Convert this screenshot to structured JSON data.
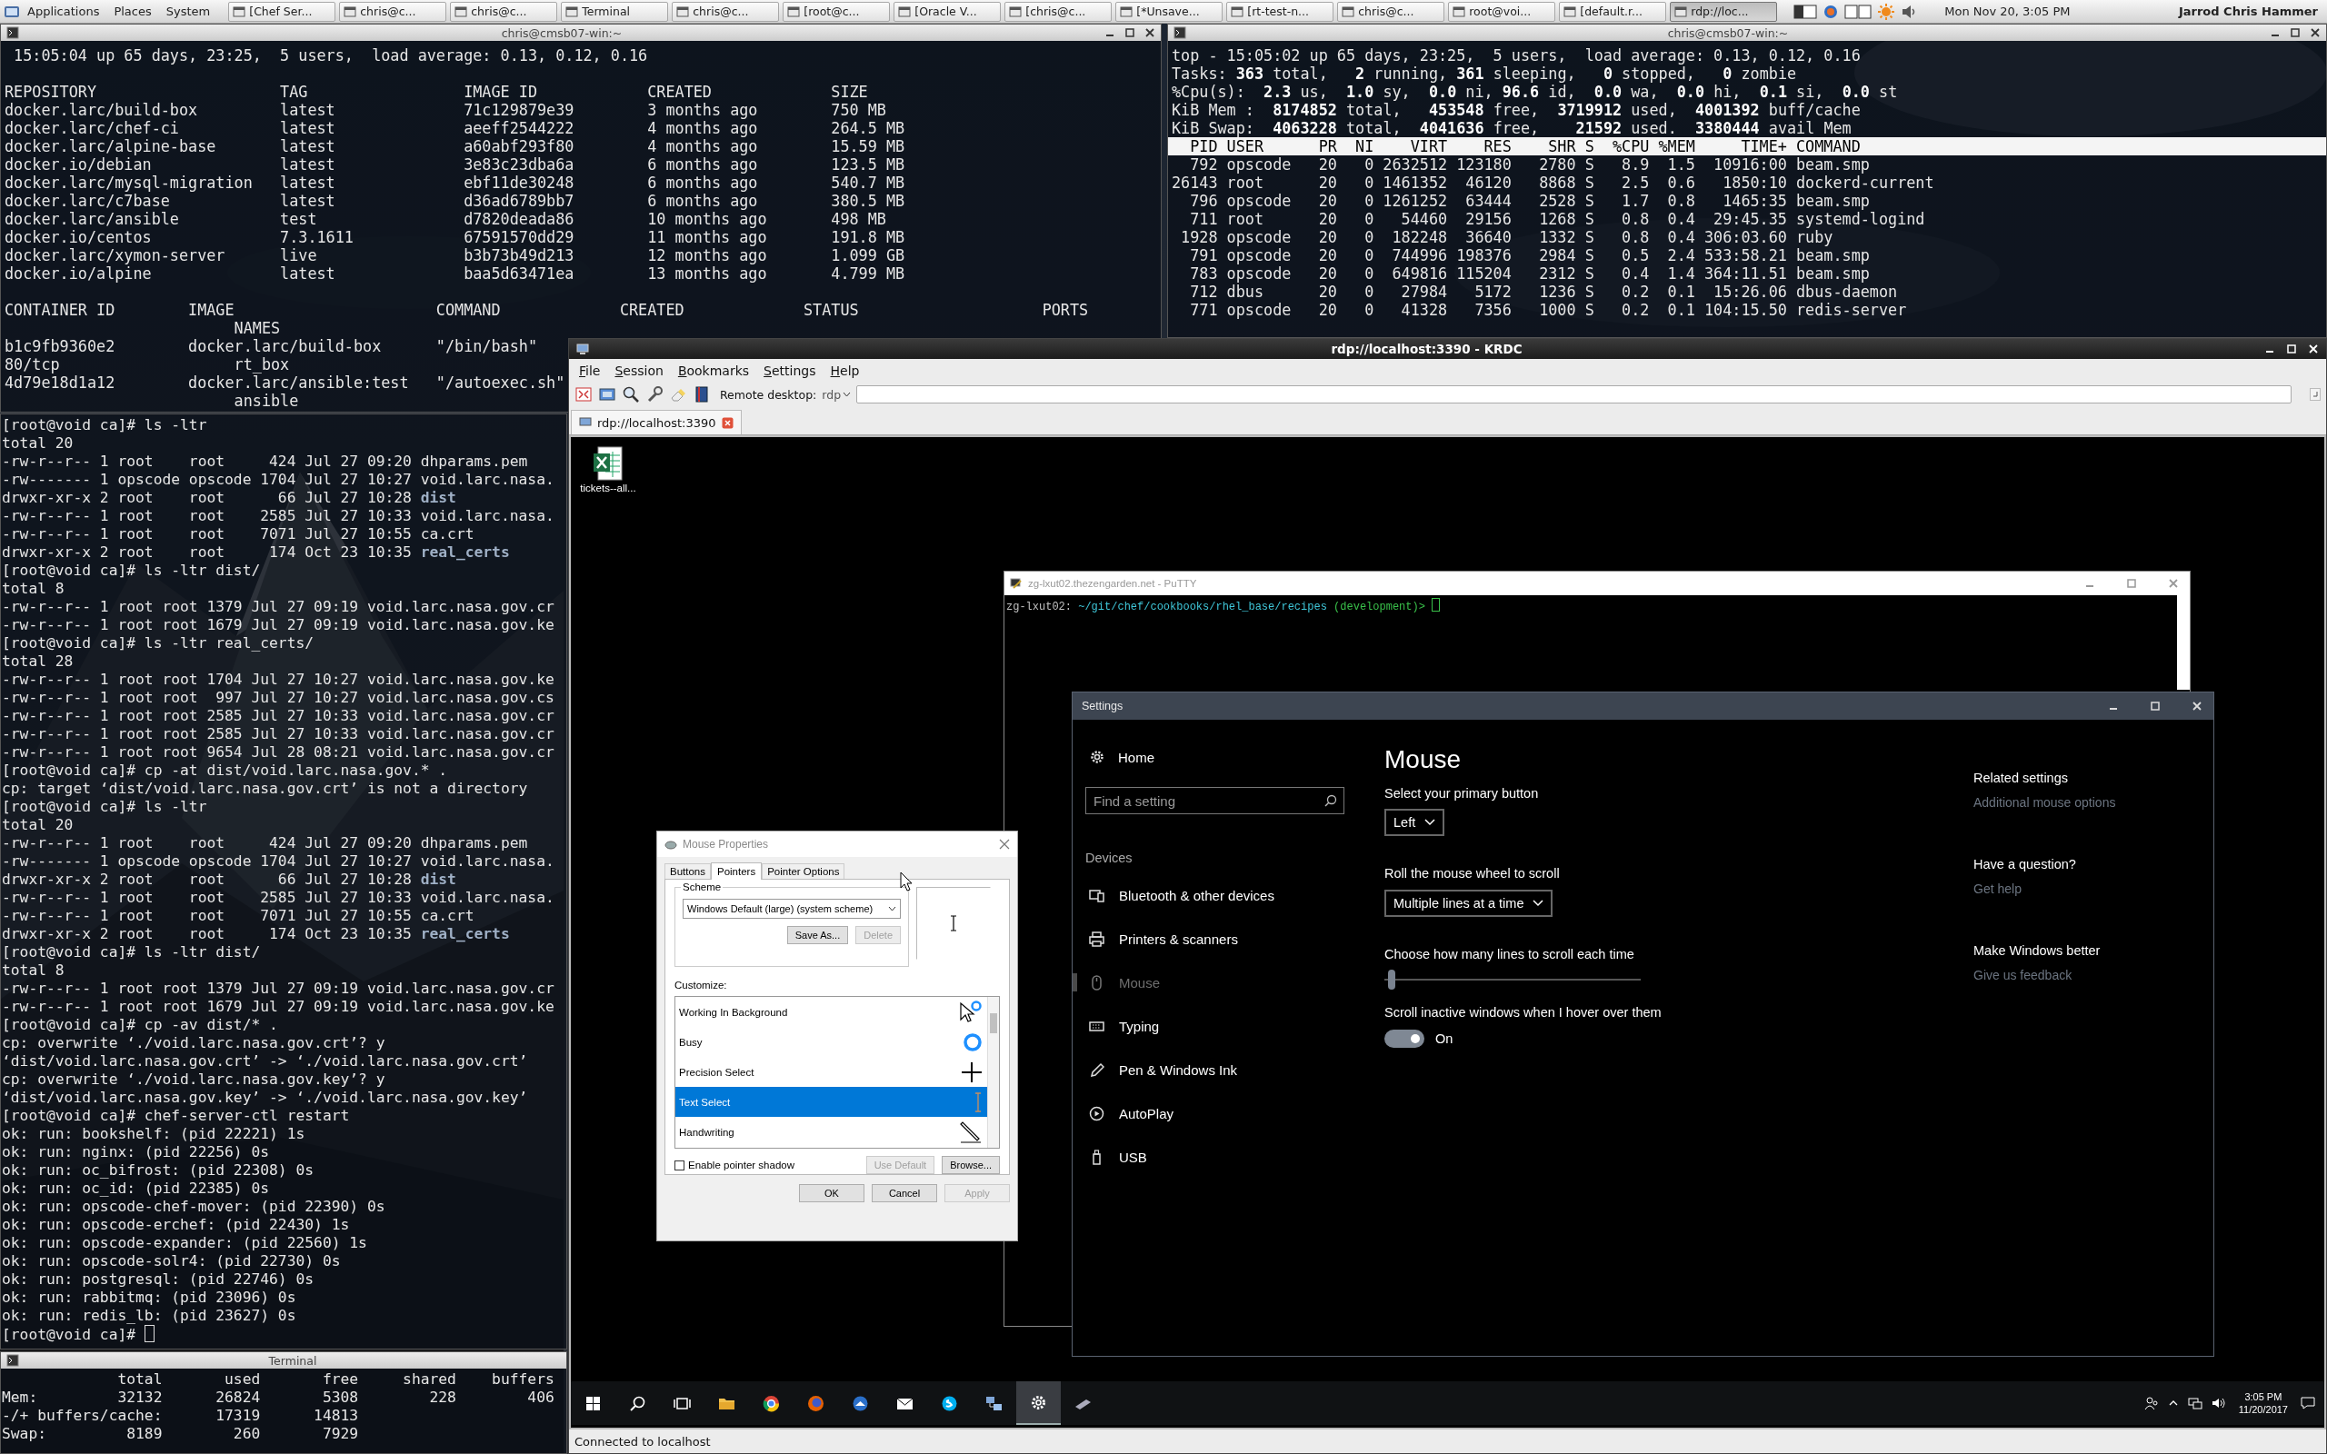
{
  "top_panel": {
    "menus": [
      "Applications",
      "Places",
      "System"
    ],
    "tasks": [
      {
        "label": "[Chef Ser...",
        "selected": false
      },
      {
        "label": "chris@c...",
        "selected": false
      },
      {
        "label": "chris@c...",
        "selected": false
      },
      {
        "label": "Terminal",
        "selected": false
      },
      {
        "label": "chris@c...",
        "selected": false
      },
      {
        "label": "[root@c...",
        "selected": false
      },
      {
        "label": "[Oracle V...",
        "selected": false
      },
      {
        "label": "[chris@c...",
        "selected": false
      },
      {
        "label": "[*Unsave...",
        "selected": false
      },
      {
        "label": "[rt-test-n...",
        "selected": false
      },
      {
        "label": "chris@c...",
        "selected": false
      },
      {
        "label": "root@voi...",
        "selected": false
      },
      {
        "label": "[default.r...",
        "selected": false
      },
      {
        "label": "rdp://loc...",
        "selected": true
      }
    ],
    "clock": "Mon Nov 20,  3:05 PM",
    "user": "Jarrod Chris Hammer"
  },
  "docker_terminal": {
    "title": "chris@cmsb07-win:~",
    "blocks": [
      [
        " 15:05:04 up 65 days, 23:25,  5 users,  load average: 0.13, 0.12, 0.16"
      ],
      [
        "REPOSITORY                    TAG                 IMAGE ID            CREATED             SIZE",
        "docker.larc/build-box         latest              71c129879e39        3 months ago        750 MB",
        "docker.larc/chef-ci           latest              aeeff2544222        4 months ago        264.5 MB",
        "docker.larc/alpine-base       latest              a60abf293f80        4 months ago        15.59 MB",
        "docker.io/debian              latest              3e83c23dba6a        6 months ago        123.5 MB",
        "docker.larc/mysql-migration   latest              ebf11de30248        6 months ago        540.7 MB",
        "docker.larc/c7base            latest              d36ad6789bb7        6 months ago        380.5 MB",
        "docker.larc/ansible           test                d7820deada86        10 months ago       498 MB",
        "docker.io/centos              7.3.1611            67591570dd29        11 months ago       191.8 MB",
        "docker.larc/xymon-server      live                b3b73b49d213        12 months ago       1.099 GB",
        "docker.io/alpine              latest              baa5d63471ea        13 months ago       4.799 MB"
      ],
      [
        "CONTAINER ID        IMAGE                      COMMAND             CREATED             STATUS                    PORTS",
        "                         NAMES",
        "b1c9fb9360e2        docker.larc/build-box      \"/bin/bash\"",
        "80/tcp                   rt_box",
        "4d79e18d1a12        docker.larc/ansible:test   \"/autoexec.sh\"",
        "                         ansible"
      ]
    ]
  },
  "top_terminal": {
    "title": "chris@cmsb07-win:~",
    "blocks": [
      [
        "top - 15:05:02 up 65 days, 23:25,  5 users,  load average: 0.13, 0.12, 0.16",
        "Tasks: **363** total,   **2** running, **361** sleeping,   **0** stopped,   **0** zombie",
        "%Cpu(s):  **2.3** us,  **1.0** sy,  **0.0** ni, **96.6** id,  **0.0** wa,  **0.0** hi,  **0.1** si,  **0.0** st",
        "KiB Mem :  **8174852** total,   **453548** free,  **3719912** used,  **4001392** buff/cache",
        "KiB Swap:  **4063228** total,  **4041636** free,    **21592** used.  **3380444** avail Mem"
      ]
    ],
    "header": "  PID USER      PR  NI    VIRT    RES    SHR S  %CPU %MEM     TIME+ COMMAND",
    "rows": [
      "  792 opscode   20   0 2632512 123180   2780 S   8.9  1.5  10916:00 beam.smp",
      "26143 root      20   0 1461352  46120   8868 S   2.5  0.6   1850:10 dockerd-current",
      "  796 opscode   20   0 1261252  63444   2528 S   1.7  0.8   1465:35 beam.smp",
      "  711 root      20   0   54460  29156   1268 S   0.8  0.4  29:45.35 systemd-logind",
      " 1928 opscode   20   0  182248  36640   1332 S   0.8  0.4 306:03.60 ruby",
      "  791 opscode   20   0  744996 198376   2984 S   0.5  2.4 533:58.21 beam.smp",
      "  783 opscode   20   0  649816 115204   2312 S   0.4  1.4 364:11.51 beam.smp",
      "  712 dbus      20   0   27984   5172   1236 S   0.2  0.1  15:26.06 dbus-daemon",
      "  771 opscode   20   0   41328   7356   1000 S   0.2  0.1 104:15.50 redis-server"
    ]
  },
  "shell_terminal": {
    "cursor": true,
    "blocks": [
      [
        "[root@void ca]# ls -ltr",
        "total 20",
        "-rw-r--r-- 1 root    root     424 Jul 27 09:20 dhparams.pem",
        "-rw------- 1 opscode opscode 1704 Jul 27 10:27 void.larc.nasa.",
        "drwxr-xr-x 2 root    root      66 Jul 27 10:28 **dist**",
        "-rw-r--r-- 1 root    root    2585 Jul 27 10:33 void.larc.nasa.",
        "-rw-r--r-- 1 root    root    7071 Jul 27 10:55 ca.crt",
        "drwxr-xr-x 2 root    root     174 Oct 23 10:35 **real_certs**",
        "[root@void ca]# ls -ltr dist/",
        "total 8",
        "-rw-r--r-- 1 root root 1379 Jul 27 09:19 void.larc.nasa.gov.cr",
        "-rw-r--r-- 1 root root 1679 Jul 27 09:19 void.larc.nasa.gov.ke",
        "[root@void ca]# ls -ltr real_certs/",
        "total 28",
        "-rw-r--r-- 1 root root 1704 Jul 27 10:27 void.larc.nasa.gov.ke",
        "-rw-r--r-- 1 root root  997 Jul 27 10:27 void.larc.nasa.gov.cs",
        "-rw-r--r-- 1 root root 2585 Jul 27 10:33 void.larc.nasa.gov.cr",
        "-rw-r--r-- 1 root root 2585 Jul 27 10:33 void.larc.nasa.gov.cr",
        "-rw-r--r-- 1 root root 9654 Jul 28 08:21 void.larc.nasa.gov.cr",
        "[root@void ca]# cp -at dist/void.larc.nasa.gov.* .",
        "cp: target ‘dist/void.larc.nasa.gov.crt’ is not a directory",
        "[root@void ca]# ls -ltr",
        "total 20",
        "-rw-r--r-- 1 root    root     424 Jul 27 09:20 dhparams.pem",
        "-rw------- 1 opscode opscode 1704 Jul 27 10:27 void.larc.nasa.",
        "drwxr-xr-x 2 root    root      66 Jul 27 10:28 **dist**",
        "-rw-r--r-- 1 root    root    2585 Jul 27 10:33 void.larc.nasa.",
        "-rw-r--r-- 1 root    root    7071 Jul 27 10:55 ca.crt",
        "drwxr-xr-x 2 root    root     174 Oct 23 10:35 **real_certs**",
        "[root@void ca]# ls -ltr dist/",
        "total 8",
        "-rw-r--r-- 1 root root 1379 Jul 27 09:19 void.larc.nasa.gov.cr",
        "-rw-r--r-- 1 root root 1679 Jul 27 09:19 void.larc.nasa.gov.ke",
        "[root@void ca]# cp -av dist/* .",
        "cp: overwrite ‘./void.larc.nasa.gov.crt’? y",
        "‘dist/void.larc.nasa.gov.crt’ -> ‘./void.larc.nasa.gov.crt’",
        "cp: overwrite ‘./void.larc.nasa.gov.key’? y",
        "‘dist/void.larc.nasa.gov.key’ -> ‘./void.larc.nasa.gov.key’",
        "[root@void ca]# chef-server-ctl restart",
        "ok: run: bookshelf: (pid 22221) 1s",
        "ok: run: nginx: (pid 22256) 0s",
        "ok: run: oc_bifrost: (pid 22308) 0s",
        "ok: run: oc_id: (pid 22385) 0s",
        "ok: run: opscode-chef-mover: (pid 22390) 0s",
        "ok: run: opscode-erchef: (pid 22430) 1s",
        "ok: run: opscode-expander: (pid 22560) 1s",
        "ok: run: opscode-solr4: (pid 22730) 0s",
        "ok: run: postgresql: (pid 22746) 0s",
        "ok: run: rabbitmq: (pid 23096) 0s",
        "ok: run: redis_lb: (pid 23627) 0s",
        "[root@void ca]#"
      ]
    ]
  },
  "free_terminal": {
    "title": "Terminal",
    "blocks": [
      [
        "             total       used       free     shared    buffers",
        "Mem:         32132      26824       5308        228        406",
        "-/+ buffers/cache:      17319      14813",
        "Swap:         8189        260       7929"
      ]
    ]
  },
  "krdc": {
    "title": "rdp://localhost:3390 - KRDC",
    "menus": [
      "File",
      "Session",
      "Bookmarks",
      "Settings",
      "Help"
    ],
    "remote_label": "Remote desktop:",
    "protocol": "rdp",
    "tab": "rdp://localhost:3390",
    "status": "Connected to localhost",
    "remote": {
      "desktop_icons": [
        {
          "label": "tickets--all..."
        }
      ],
      "putty": {
        "title": "zg-lxut02.thezengarden.net - PuTTY",
        "cursor": true,
        "prompt": {
          "host": "zg-lxut02:",
          "path": "~/git/chef/cookbooks/rhel_base/recipes",
          "branch": "(development)>"
        }
      },
      "settings": {
        "title": "Settings",
        "home": "Home",
        "search": {
          "placeholder": "Find a setting"
        },
        "section": "Devices",
        "nav": [
          {
            "label": "Bluetooth & other devices",
            "kind": "devices",
            "selected": false
          },
          {
            "label": "Printers & scanners",
            "kind": "printer",
            "selected": false
          },
          {
            "label": "Mouse",
            "kind": "mouse",
            "selected": true
          },
          {
            "label": "Typing",
            "kind": "keyboard",
            "selected": false
          },
          {
            "label": "Pen & Windows Ink",
            "kind": "pen",
            "selected": false
          },
          {
            "label": "AutoPlay",
            "kind": "autoplay",
            "selected": false
          },
          {
            "label": "USB",
            "kind": "usb",
            "selected": false
          }
        ],
        "page_title": "Mouse",
        "primary_button": {
          "label": "Select your primary button",
          "value": "Left"
        },
        "wheel": {
          "label": "Roll the mouse wheel to scroll",
          "value": "Multiple lines at a time"
        },
        "lines": {
          "label": "Choose how many lines to scroll each time",
          "level": 0.03
        },
        "inactive_scroll": {
          "label": "Scroll inactive windows when I hover over them",
          "on": true,
          "state": "On"
        },
        "related": [
          {
            "heading": "Related settings",
            "link": "Additional mouse options"
          },
          {
            "heading": "Have a question?",
            "link": "Get help"
          },
          {
            "heading": "Make Windows better",
            "link": "Give us feedback"
          }
        ]
      },
      "mouse_properties": {
        "title": "Mouse Properties",
        "tabs": [
          {
            "label": "Buttons",
            "selected": false
          },
          {
            "label": "Pointers",
            "selected": true
          },
          {
            "label": "Pointer Options",
            "selected": false
          }
        ],
        "scheme_label": "Scheme",
        "scheme": "Windows Default (large) (system scheme)",
        "save_as": "Save As...",
        "delete": {
          "label": "Delete",
          "disabled": true
        },
        "customize_label": "Customize:",
        "pointers": [
          {
            "label": "Working In Background",
            "kind": "working",
            "selected": false
          },
          {
            "label": "Busy",
            "kind": "busy",
            "selected": false
          },
          {
            "label": "Precision Select",
            "kind": "precision",
            "selected": false
          },
          {
            "label": "Text Select",
            "kind": "text",
            "selected": true
          },
          {
            "label": "Handwriting",
            "kind": "handwriting",
            "selected": false
          }
        ],
        "shadow": {
          "label": "Enable pointer shadow",
          "checked": false
        },
        "use_default": {
          "label": "Use Default",
          "disabled": true
        },
        "browse": "Browse...",
        "buttons": [
          {
            "label": "OK",
            "disabled": false
          },
          {
            "label": "Cancel",
            "disabled": false
          },
          {
            "label": "Apply",
            "disabled": true
          }
        ]
      },
      "taskbar": {
        "apps": [
          {
            "selected": false
          },
          {
            "selected": false
          },
          {
            "selected": false
          },
          {
            "selected": false
          },
          {
            "selected": false
          },
          {
            "selected": false
          },
          {
            "selected": false
          },
          {
            "selected": false
          },
          {
            "selected": false
          },
          {
            "selected": false
          },
          {
            "selected": true
          },
          {
            "selected": false
          }
        ],
        "time": "3:05 PM",
        "date": "11/20/2017"
      }
    }
  }
}
